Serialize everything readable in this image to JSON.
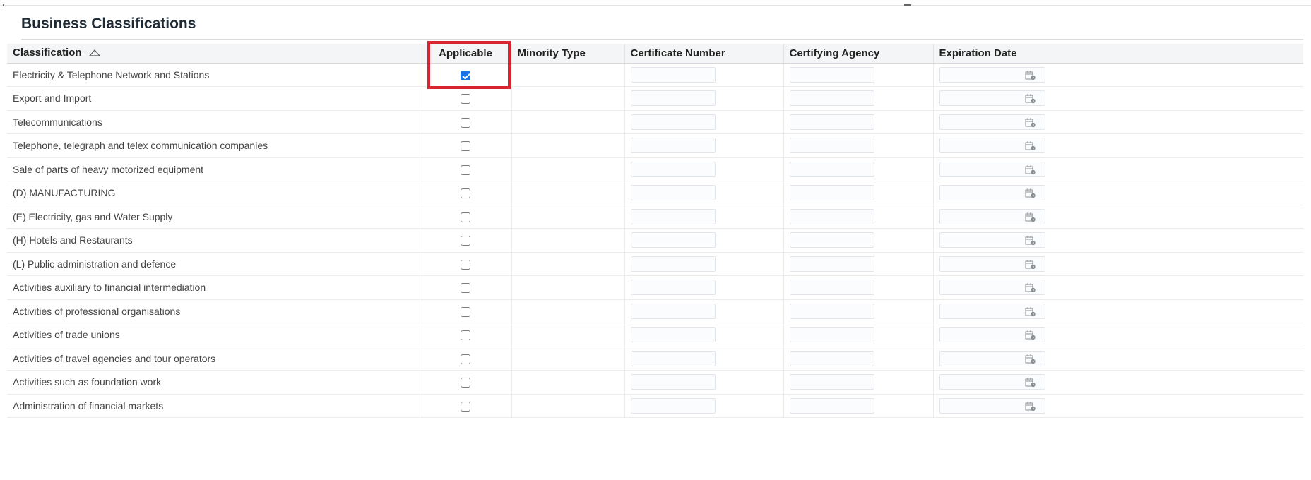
{
  "section": {
    "title": "Business Classifications"
  },
  "table": {
    "columns": {
      "classification": "Classification",
      "applicable": "Applicable",
      "minority_type": "Minority Type",
      "certificate_number": "Certificate Number",
      "certifying_agency": "Certifying Agency",
      "expiration_date": "Expiration Date"
    },
    "sort": "ascending",
    "rows": [
      {
        "classification": "Electricity & Telephone Network and Stations",
        "applicable": true
      },
      {
        "classification": "Export and Import",
        "applicable": false
      },
      {
        "classification": "Telecommunications",
        "applicable": false
      },
      {
        "classification": "Telephone, telegraph and telex communication companies",
        "applicable": false
      },
      {
        "classification": "Sale of parts of heavy motorized equipment",
        "applicable": false
      },
      {
        "classification": "(D) MANUFACTURING",
        "applicable": false
      },
      {
        "classification": "(E) Electricity, gas and Water Supply",
        "applicable": false
      },
      {
        "classification": "(H) Hotels and Restaurants",
        "applicable": false
      },
      {
        "classification": "(L) Public administration and defence",
        "applicable": false
      },
      {
        "classification": "Activities auxiliary to financial intermediation",
        "applicable": false
      },
      {
        "classification": "Activities of professional organisations",
        "applicable": false
      },
      {
        "classification": "Activities of trade unions",
        "applicable": false
      },
      {
        "classification": "Activities of travel agencies and tour operators",
        "applicable": false
      },
      {
        "classification": "Activities such as foundation work",
        "applicable": false
      },
      {
        "classification": "Administration of financial markets",
        "applicable": false
      }
    ]
  },
  "icons": {
    "sort": "sort-ascending-icon",
    "calendar": "calendar-icon"
  },
  "colors": {
    "highlight": "#d9232e",
    "checkbox_checked": "#1a73e8",
    "header_bg": "#f4f5f6"
  }
}
